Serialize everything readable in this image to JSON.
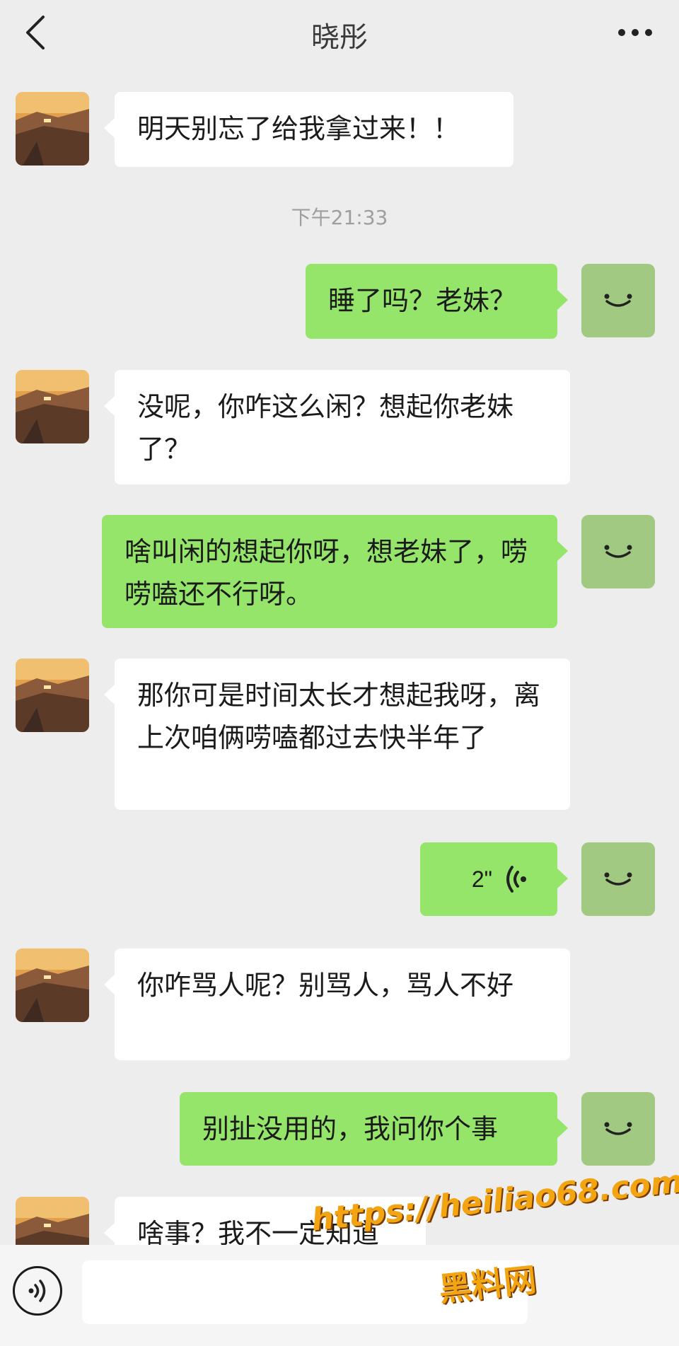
{
  "header": {
    "title": "晓彤"
  },
  "messages": [
    {
      "side": "in",
      "text": "明天别忘了给我拿过来！！"
    },
    {
      "side": "out",
      "text": "睡了吗？老妹？"
    },
    {
      "side": "in",
      "text": "没呢，你咋这么闲？想起你老妹了？"
    },
    {
      "side": "out",
      "text": "啥叫闲的想起你呀，想老妹了，唠唠嗑还不行呀。"
    },
    {
      "side": "in",
      "text": "那你可是时间太长才想起我呀，离上次咱俩唠嗑都过去快半年了"
    },
    {
      "side": "out",
      "type": "voice",
      "duration": "2\""
    },
    {
      "side": "in",
      "text": "你咋骂人呢？别骂人，骂人不好"
    },
    {
      "side": "out",
      "text": "别扯没用的，我问你个事"
    },
    {
      "side": "in",
      "text": "啥事？我不一定知道"
    }
  ],
  "timestamp": "下午21:33",
  "input_bar": {
    "placeholder": ""
  },
  "watermark": {
    "url": "https://heiliao68.com",
    "name": "黑料网"
  },
  "colors": {
    "background": "#ededed",
    "incoming_bubble": "#ffffff",
    "outgoing_bubble": "#95e56b",
    "self_avatar": "#a1c982",
    "watermark": "#f2a411"
  }
}
